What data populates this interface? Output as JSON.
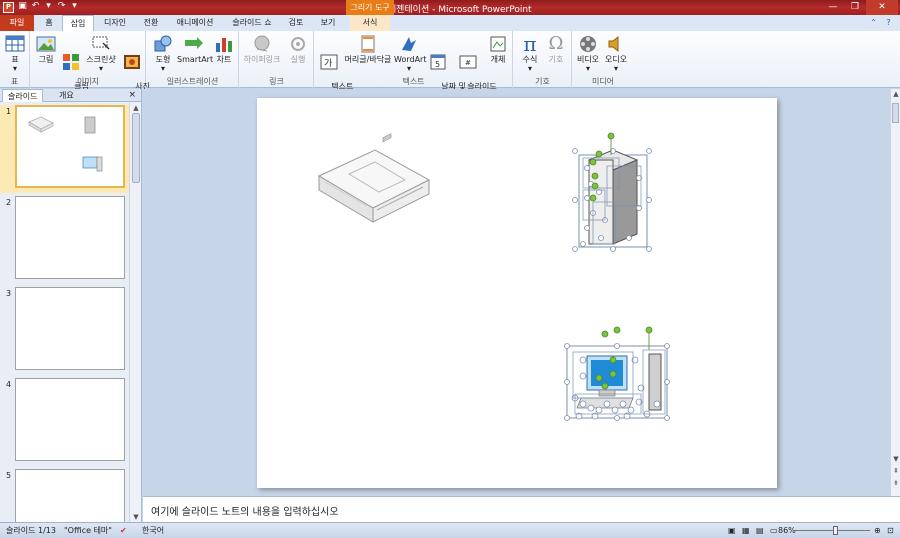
{
  "window": {
    "title": "새 프레젠테이션 - Microsoft PowerPoint",
    "context_tool": "그리기 도구",
    "app_icon_letter": "P"
  },
  "tabs": [
    "파일",
    "홈",
    "삽입",
    "디자인",
    "전환",
    "애니메이션",
    "슬라이드 쇼",
    "검토",
    "보기",
    "서식"
  ],
  "ribbon": {
    "groups": {
      "table": "표",
      "images": "이미지",
      "illustrations": "일러스트레이션",
      "links": "링크",
      "text": "텍스트",
      "symbols": "기호",
      "media": "미디어"
    },
    "buttons": {
      "table": "표",
      "picture": "그림",
      "clipart": "클립\n아트",
      "screenshot": "스크린샷",
      "photo_album": "사진\n앨범",
      "shapes": "도형",
      "smartart": "SmartArt",
      "chart": "차트",
      "hyperlink": "하이퍼링크",
      "action": "실행",
      "textbox": "텍스트\n상자",
      "header_footer": "머리글/바닥글",
      "wordart": "WordArt",
      "datetime": "날짜 및\n시간",
      "slide_number": "슬라이드\n번호",
      "object": "개체",
      "equation": "수식",
      "symbol": "기호",
      "video": "비디오",
      "audio": "오디오"
    }
  },
  "panel": {
    "tab_slides": "슬라이드",
    "tab_outline": "개요",
    "close": "×",
    "slides": [
      "1",
      "2",
      "3",
      "4",
      "5"
    ]
  },
  "notes": {
    "placeholder": "여기에 슬라이드 노트의 내용을 입력하십시오"
  },
  "status": {
    "slide_info": "슬라이드 1/13",
    "theme": "\"Office 테마\"",
    "language": "한국어",
    "zoom": "86%"
  },
  "colors": {
    "title_bar": "#9c2020",
    "file_tab": "#c43b1c",
    "context_tab": "#e87d17",
    "selection_handle": "#7cc142",
    "shape_fill_blue": "#1f8ad6"
  }
}
